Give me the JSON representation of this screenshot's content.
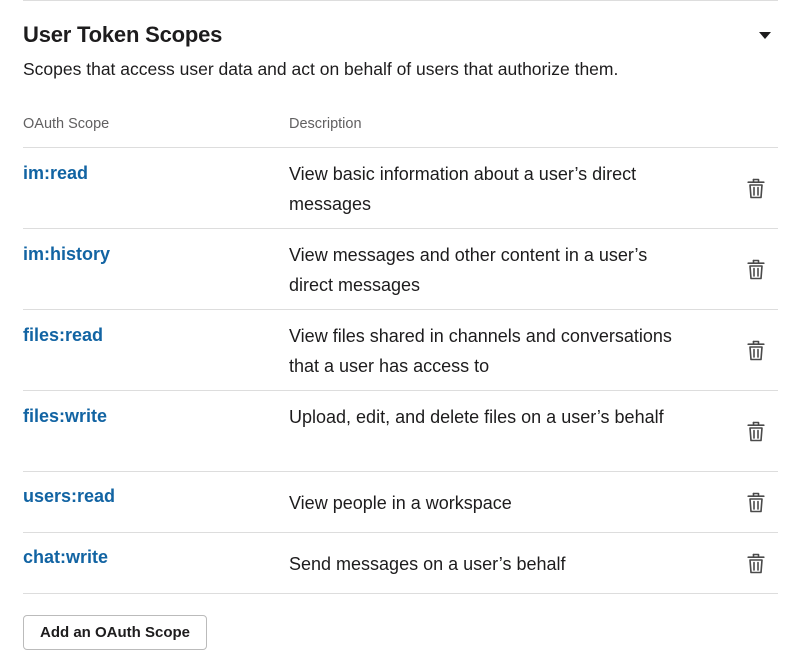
{
  "section": {
    "title": "User Token Scopes",
    "subtitle": "Scopes that access user data and act on behalf of users that authorize them.",
    "collapse_icon": "caret-down-icon"
  },
  "table": {
    "headers": {
      "scope": "OAuth Scope",
      "description": "Description"
    },
    "rows": [
      {
        "scope": "im:read",
        "description": "View basic information about a user’s direct messages",
        "action_icon": "trash-icon"
      },
      {
        "scope": "im:history",
        "description": "View messages and other content in a user’s direct messages",
        "action_icon": "trash-icon"
      },
      {
        "scope": "files:read",
        "description": "View files shared in channels and conversations that a user has access to",
        "action_icon": "trash-icon"
      },
      {
        "scope": "files:write",
        "description": "Upload, edit, and delete files on a user’s behalf",
        "action_icon": "trash-icon"
      },
      {
        "scope": "users:read",
        "description": "View people in a workspace",
        "action_icon": "trash-icon"
      },
      {
        "scope": "chat:write",
        "description": "Send messages on a user’s behalf",
        "action_icon": "trash-icon"
      }
    ]
  },
  "add_button": {
    "label": "Add an OAuth Scope"
  },
  "colors": {
    "link": "#1264a3",
    "text": "#1d1c1d",
    "muted": "#616061",
    "divider": "#dddddd"
  }
}
